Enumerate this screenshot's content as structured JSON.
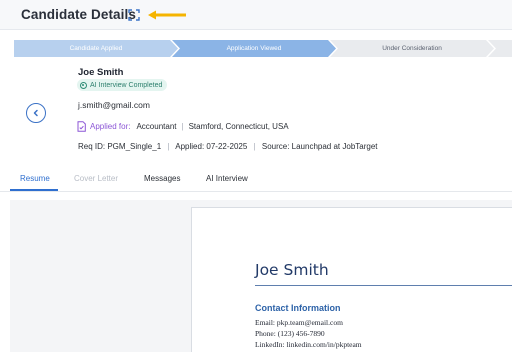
{
  "header": {
    "title": "Candidate Details"
  },
  "colors": {
    "accent": "#2f6fcf",
    "arrow": "#f5b400",
    "badge_text": "#2d7f6d",
    "applied_for": "#8c56d6",
    "resume_heading": "#2e63a8"
  },
  "icons": {
    "expand": "expand-icon",
    "annotation_arrow": "arrow-left-icon",
    "back": "chevron-left-icon",
    "badge": "check-circle-icon",
    "applied": "document-icon"
  },
  "steps": [
    {
      "label": "Candidate Applied",
      "state": "completed"
    },
    {
      "label": "Application Viewed",
      "state": "current"
    },
    {
      "label": "Under Consideration",
      "state": "upcoming"
    },
    {
      "label": "",
      "state": "upcoming"
    }
  ],
  "candidate": {
    "name": "Joe Smith",
    "badge": "AI Interview Completed",
    "email": "j.smith@gmail.com",
    "applied_for_label": "Applied for:",
    "job_title": "Accountant",
    "location": "Stamford, Connecticut, USA",
    "req_id": "Req ID: PGM_Single_1",
    "applied_date": "Applied: 07-22-2025",
    "source": "Source: Launchpad at JobTarget"
  },
  "tabs": [
    {
      "label": "Resume",
      "state": "active"
    },
    {
      "label": "Cover Letter",
      "state": "disabled"
    },
    {
      "label": "Messages",
      "state": "normal"
    },
    {
      "label": "AI Interview",
      "state": "normal"
    }
  ],
  "resume": {
    "name": "Joe Smith",
    "section_heading": "Contact Information",
    "lines": [
      "Email: pkp.team@email.com",
      "Phone: (123) 456-7890",
      "LinkedIn: linkedin.com/in/pkpteam"
    ]
  }
}
